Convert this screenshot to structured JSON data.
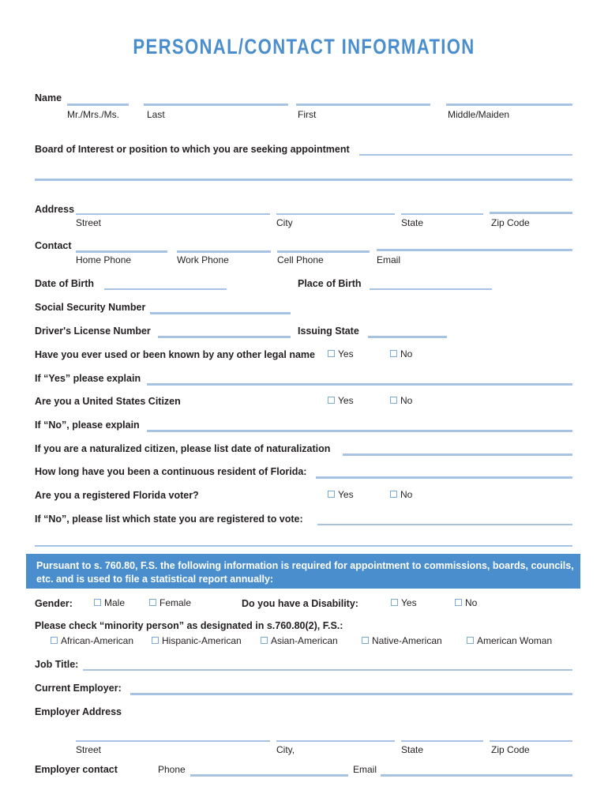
{
  "document": {
    "title": "PERSONAL/CONTACT INFORMATION",
    "accent_color": "#4a8ecd",
    "rule_color": "#a8c2e4",
    "text_color": "#231f20"
  },
  "name_row": {
    "label": "Name",
    "sublabels": [
      "Mr./Mrs./Ms.",
      "Last",
      "First",
      "Middle/Maiden"
    ]
  },
  "board": {
    "label": "Board of Interest or position to which you are seeking appointment"
  },
  "address_row": {
    "label": "Address",
    "sublabels": [
      "Street",
      "City",
      "State",
      "Zip Code"
    ]
  },
  "contact_row": {
    "label": "Contact",
    "sublabels": [
      "Home Phone",
      "Work Phone",
      "Cell Phone",
      "Email"
    ]
  },
  "birth": {
    "date_label": "Date of Birth",
    "place_label": "Place of Birth"
  },
  "ssn": {
    "label": "Social Security Number"
  },
  "license": {
    "number_label": "Driver's License Number",
    "state_label": "Issuing State"
  },
  "questions": {
    "other_name": {
      "label": "Have you ever used or been known by any other legal name",
      "yes": "Yes",
      "no": "No"
    },
    "other_name_explain": {
      "label": "If “Yes” please explain"
    },
    "citizen": {
      "label": "Are you a United States Citizen",
      "yes": "Yes",
      "no": "No"
    },
    "citizen_explain": {
      "label": "If “No”, please explain"
    },
    "naturalization": {
      "label": "If you are a naturalized citizen, please list date of naturalization"
    },
    "residency": {
      "label": "How long have you been a continuous resident of Florida:"
    },
    "voter": {
      "label": "Are you a registered Florida voter?",
      "yes": "Yes",
      "no": "No"
    },
    "voter_state": {
      "label": "If “No”, please list which state you are registered to vote:"
    }
  },
  "banner": {
    "text": "Pursuant to s. 760.80, F.S. the following information is required for appointment to commissions, boards, councils, etc. and is used to file a statistical report annually:"
  },
  "gender": {
    "label": "Gender:",
    "options": [
      "Male",
      "Female"
    ]
  },
  "disability": {
    "label": "Do you have a Disability:",
    "yes": "Yes",
    "no": "No"
  },
  "minority": {
    "label": "Please check “minority person” as designated in s.760.80(2), F.S.:",
    "options": [
      "African-American",
      "Hispanic-American",
      "Asian-American",
      "Native-American",
      "American Woman"
    ]
  },
  "employment": {
    "job_title_label": "Job Title:",
    "current_employer_label": "Current Employer:",
    "employer_address_label": "Employer Address",
    "address_sublabels": [
      "Street",
      "City,",
      "State",
      "Zip Code"
    ],
    "employer_contact_label": "Employer contact",
    "phone_label": "Phone",
    "email_label": "Email"
  }
}
